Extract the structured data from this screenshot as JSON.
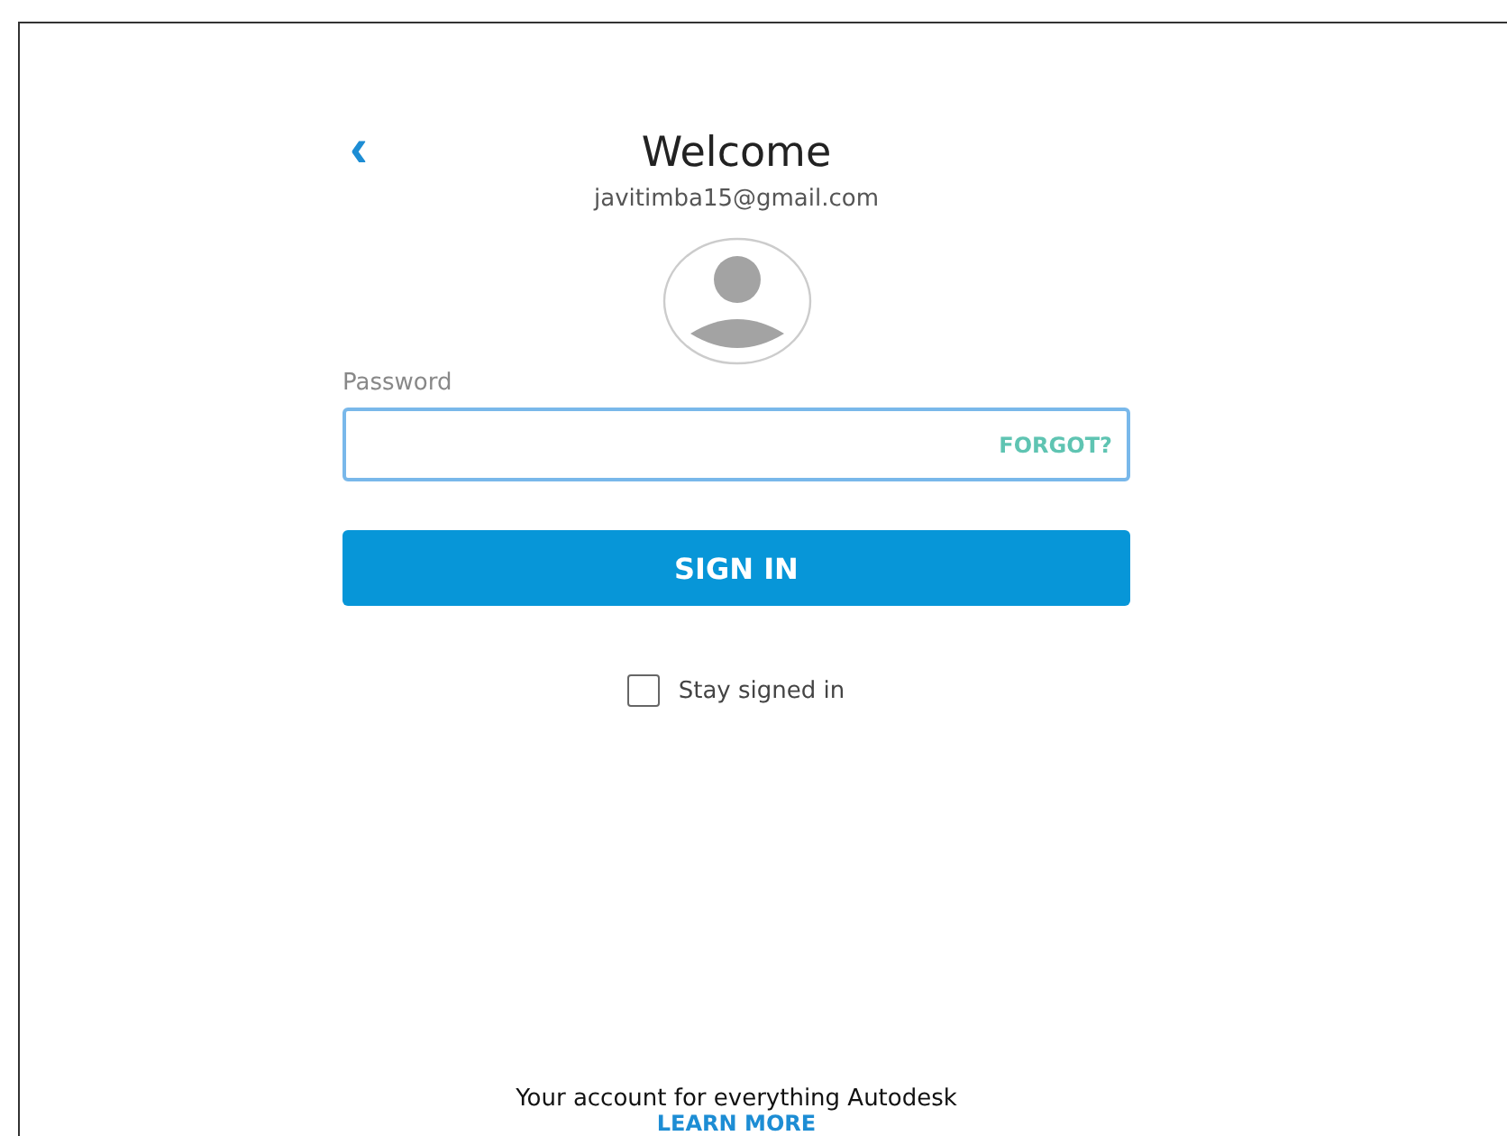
{
  "header": {
    "back": "‹",
    "title": "Welcome",
    "email": "javitimba15@gmail.com"
  },
  "password": {
    "label": "Password",
    "forgot": "FORGOT?",
    "focused": true
  },
  "sign_in": "SIGN IN",
  "stay_signed_in": {
    "label": "Stay signed in",
    "checked": false
  },
  "footer": {
    "text": "Your account for everything Autodesk",
    "link": "LEARN MORE"
  }
}
